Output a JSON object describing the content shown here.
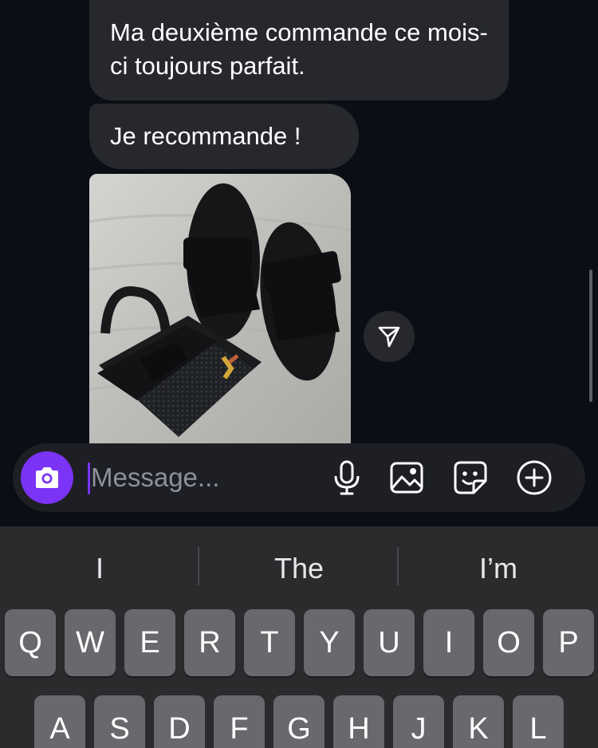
{
  "chat": {
    "messages": [
      {
        "text": "Ma deuxième commande ce mois-ci toujours parfait."
      },
      {
        "text": "Je recommande !"
      }
    ],
    "photo_icon": "shared-photo",
    "share_icon": "paper-plane-icon"
  },
  "composer": {
    "placeholder": "Message...",
    "value": "",
    "icons": [
      "camera-icon",
      "microphone-icon",
      "gallery-icon",
      "sticker-icon",
      "plus-circle-icon"
    ],
    "accent_color": "#7b33f5"
  },
  "keyboard": {
    "suggestions": [
      "I",
      "The",
      "I’m"
    ],
    "rows": [
      [
        "Q",
        "W",
        "E",
        "R",
        "T",
        "Y",
        "U",
        "I",
        "O",
        "P"
      ],
      [
        "A",
        "S",
        "D",
        "F",
        "G",
        "H",
        "J",
        "K",
        "L"
      ]
    ]
  }
}
